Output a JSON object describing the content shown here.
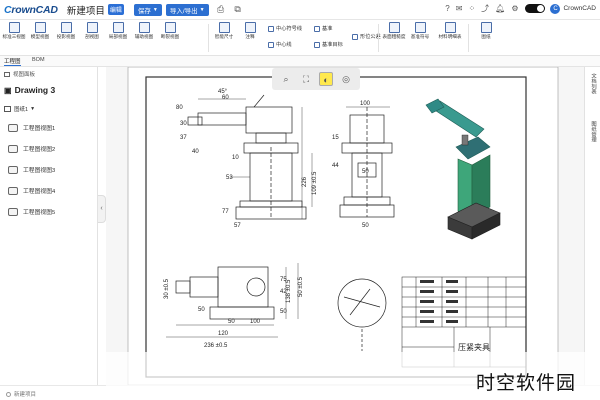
{
  "titlebar": {
    "logo_prefix": "C",
    "logo_text": "rownCAD",
    "project_title": "新建项目",
    "project_badge": "编辑",
    "btn_save": "保存",
    "btn_import": "导入/导出",
    "username": "CrownCAD"
  },
  "ribbon": {
    "tools": [
      {
        "label": "标准三视图"
      },
      {
        "label": "模型视图"
      },
      {
        "label": "投影视图"
      },
      {
        "label": "剖视图"
      },
      {
        "label": "局部视图"
      },
      {
        "label": "辅助视图"
      },
      {
        "label": "断裂视图"
      }
    ],
    "tools2": [
      {
        "label": "智能尺寸"
      },
      {
        "label": "注释"
      }
    ],
    "small": [
      {
        "label": "中心符号线"
      },
      {
        "label": "中心线"
      },
      {
        "label": "基准"
      },
      {
        "label": "基准目标"
      },
      {
        "label": "形位公差"
      }
    ],
    "tools3": [
      {
        "label": "表面粗糙度"
      },
      {
        "label": "基准符号"
      },
      {
        "label": "材料明细表"
      },
      {
        "label": "图纸"
      }
    ]
  },
  "tabs": [
    {
      "label": "工程图"
    },
    {
      "label": "BOM"
    }
  ],
  "leftpanel": {
    "view_label": "视图面板",
    "drawing_title": "Drawing 3",
    "group_label": "图纸1",
    "items": [
      {
        "label": "工程图视图1"
      },
      {
        "label": "工程图视图2"
      },
      {
        "label": "工程图视图3"
      },
      {
        "label": "工程图视图4"
      },
      {
        "label": "工程图视图5"
      }
    ]
  },
  "drawing": {
    "dims_front": [
      "45°",
      "60",
      "80",
      "30",
      "37",
      "10",
      "53",
      "77",
      "57",
      "226",
      "109 ±0.5",
      "40"
    ],
    "dims_side": [
      "100",
      "50",
      "44",
      "50",
      "15"
    ],
    "dims_top": [
      "30 ±0.5",
      "50",
      "50",
      "100",
      "120",
      "236 ±0.5",
      "138 ±0.5",
      "50 ±0.5",
      "75",
      "42",
      "50"
    ],
    "title_block_name": "压紧夹具"
  },
  "rightpanel": {
    "tabs": [
      {
        "label": "文档列表"
      },
      {
        "label": "图纸管理"
      }
    ]
  },
  "status": {
    "label": "新建项目"
  },
  "watermark": "时空软件园",
  "colors": {
    "accent": "#2c6fd1",
    "model_green": "#3ea67a",
    "model_teal": "#2f8a86"
  }
}
